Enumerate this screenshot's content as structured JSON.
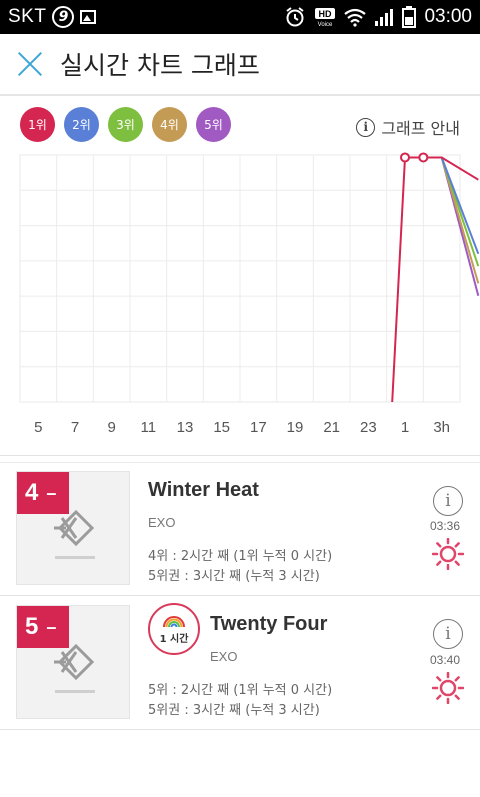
{
  "status_bar": {
    "carrier": "SKT",
    "carrier_icon": "9",
    "time": "03:00",
    "icons": [
      "alarm-icon",
      "hd-voice-icon",
      "wifi-icon",
      "signal-icon",
      "battery-icon"
    ]
  },
  "header": {
    "close_icon": "close-icon",
    "title": "실시간 차트 그래프"
  },
  "legend": {
    "items": [
      {
        "label": "1위",
        "color": "#d42650"
      },
      {
        "label": "2위",
        "color": "#5a7fd6"
      },
      {
        "label": "3위",
        "color": "#7fbf3f"
      },
      {
        "label": "4위",
        "color": "#c49b55"
      },
      {
        "label": "5위",
        "color": "#a05ac2"
      }
    ],
    "guide_label": "그래프 안내"
  },
  "chart_data": {
    "type": "line",
    "x": [
      "5",
      "7",
      "9",
      "11",
      "13",
      "15",
      "17",
      "19",
      "21",
      "23",
      "1",
      "3h"
    ],
    "ylim": [
      0,
      100
    ],
    "y_inverted": true,
    "grid": true,
    "series": [
      {
        "values": [
          null,
          null,
          null,
          null,
          null,
          null,
          null,
          null,
          null,
          null,
          1,
          1,
          10
        ],
        "color": "#d42650",
        "offscreen_start": 100,
        "x_start": 9.65
      },
      {
        "values": [
          null,
          null,
          null,
          null,
          null,
          null,
          null,
          null,
          null,
          null,
          1,
          1,
          40
        ],
        "color": "#5a7fd6"
      },
      {
        "values": [
          null,
          null,
          null,
          null,
          null,
          null,
          null,
          null,
          null,
          null,
          1,
          1,
          45
        ],
        "color": "#7fbf3f"
      },
      {
        "values": [
          null,
          null,
          null,
          null,
          null,
          null,
          null,
          null,
          null,
          null,
          1,
          1,
          52
        ],
        "color": "#c49b55"
      },
      {
        "values": [
          null,
          null,
          null,
          null,
          null,
          null,
          null,
          null,
          null,
          null,
          1,
          1,
          57
        ],
        "color": "#a05ac2"
      }
    ],
    "points": [
      {
        "x": "1",
        "y": 1
      },
      {
        "x": "2",
        "y": 1
      }
    ]
  },
  "songs": [
    {
      "rank": "4",
      "change": "–",
      "title": "Winter Heat",
      "artist": "EXO",
      "stat1": "4위 : 2시간 째 (1위 누적 0 시간)",
      "stat2": "5위권 : 3시간 째 (누적 3 시간)",
      "duration": "03:36",
      "badge": null
    },
    {
      "rank": "5",
      "change": "–",
      "title": "Twenty Four",
      "artist": "EXO",
      "stat1": "5위 : 2시간 째 (1위 누적 0 시간)",
      "stat2": "5위권 : 3시간 째 (누적 3 시간)",
      "duration": "03:40",
      "badge": "1 시간"
    }
  ]
}
